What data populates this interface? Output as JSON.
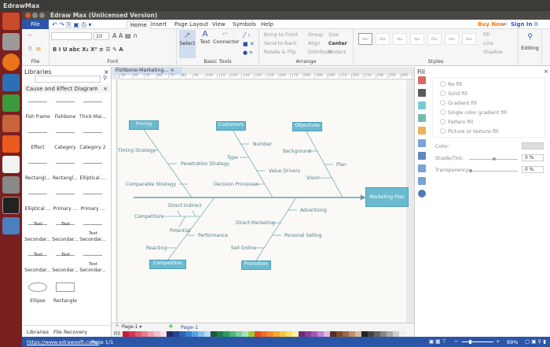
{
  "os": {
    "top_title": "EdrawMax"
  },
  "window": {
    "title": "Edraw Max (Unlicensed Version)"
  },
  "tabs": {
    "file": "File",
    "items": [
      "Home",
      "Insert",
      "Page Layout",
      "View",
      "Symbols",
      "Help"
    ],
    "buy_now": "Buy Now",
    "sign_in": "Sign In"
  },
  "ribbon": {
    "groups": {
      "file": "File",
      "font": "Font",
      "basic_tools": "Basic Tools",
      "arrange": "Arrange",
      "styles": "Styles"
    },
    "font_size": "10",
    "select": "Select",
    "text": "Text",
    "connector": "Connector",
    "arrange": [
      "Bring to Front",
      "Send to Back",
      "Rotate & Flip",
      "Group",
      "Align",
      "Distribute",
      "Size",
      "Center",
      "Protect"
    ],
    "style_sample": "Abc",
    "fill": "Fill",
    "line": "Line",
    "shadow": "Shadow",
    "editing": "Editing"
  },
  "libraries": {
    "title": "Libraries",
    "category": "Cause and Effect Diagram",
    "shapes": [
      "Fish frame",
      "Fishbone",
      "Thick Mai...",
      "Effect",
      "Category",
      "Category 2",
      "Rectangl...",
      "Rectangl...",
      "Elliptical ...",
      "Elliptical ...",
      "Primary ...",
      "Primary ...",
      "Secondar...",
      "Secondar...",
      "Secondar...",
      "Secondar...",
      "Secondar...",
      "Secondar...",
      "Ellipse",
      "Rectangle"
    ],
    "shape_text": "Text",
    "bottom_tabs": [
      "Libraries",
      "File Recovery"
    ]
  },
  "document": {
    "tab": "Fishbone-Marketing...",
    "ruler": [
      "30",
      "40",
      "50",
      "60",
      "70",
      "80",
      "90",
      "100",
      "110",
      "120",
      "130",
      "140",
      "150",
      "160",
      "170",
      "180",
      "190",
      "200",
      "210",
      "220",
      "230",
      "240",
      "250",
      "260",
      "270"
    ],
    "page_select": "Page-1",
    "page_tab": "Page-1",
    "fill_label": "Fill"
  },
  "diagram": {
    "effect": "Marketing Plan",
    "categories": {
      "pricing": "Pricing",
      "customers": "Customers",
      "objectives": "Objectives",
      "competition": "Competition",
      "promotion": "Promotion"
    },
    "causes": {
      "timing": "Timing Strategy",
      "penetration": "Penetration Strategy",
      "comparable": "Comparable Strategy",
      "number": "Number",
      "type": "Type",
      "value": "Value Drivers",
      "decision": "Decision Processes",
      "background": "Background",
      "plan": "Plan",
      "vision": "Vision",
      "direct_indirect": "Direct Indirect",
      "competitors": "Competitors",
      "potential": "Potential",
      "performance": "Performance",
      "reacting": "Reacting",
      "advertising": "Advertising",
      "direct_marketing": "Direct Marketing",
      "personal_selling": "Personal Selling",
      "sell_online": "Sell Online"
    }
  },
  "fill_panel": {
    "title": "Fill",
    "options": [
      "No fill",
      "Solid fill",
      "Gradient fill",
      "Single color gradient fill",
      "Pattern fill",
      "Picture or texture fill"
    ],
    "selected": "Solid fill",
    "color_label": "Color:",
    "shade_label": "Shade/Tint:",
    "shade_value": "0 %",
    "transparency_label": "Transparency:",
    "transparency_value": "0 %"
  },
  "status": {
    "url": "https://www.edrawsoft.com/",
    "page": "Page 1/1",
    "zoom": "89%"
  },
  "palette": [
    "#c0203a",
    "#d8354f",
    "#e05a70",
    "#e87b8e",
    "#f0a0ae",
    "#f5c0c8",
    "#f9dde2",
    "#1f2d6b",
    "#2a4590",
    "#2f63b8",
    "#3a82d0",
    "#5aa2e0",
    "#85bff0",
    "#b4d8f6",
    "#1d5a3a",
    "#237a4c",
    "#2e9a5e",
    "#4cb87a",
    "#78cf9a",
    "#a6e0bd",
    "#9acd32",
    "#e8501e",
    "#f06d22",
    "#f58a2a",
    "#f8a830",
    "#fbc83a",
    "#fde060",
    "#fdeea0",
    "#6a2a7a",
    "#8a3e9a",
    "#a65ab6",
    "#c285ce",
    "#dcb5e4",
    "#5a3020",
    "#7a4a30",
    "#9a6a48",
    "#bb9070",
    "#d6b898",
    "#222222",
    "#444444",
    "#666666",
    "#888888",
    "#aaaaaa",
    "#cccccc",
    "#eeeeee"
  ]
}
